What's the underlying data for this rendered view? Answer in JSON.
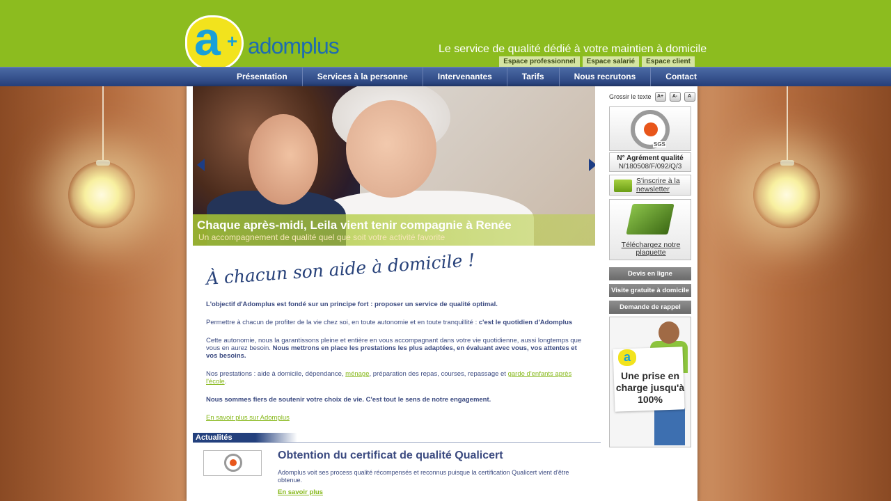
{
  "brand": {
    "name": "adomplus",
    "logo_letter": "a",
    "logo_plus": "+",
    "tagline": "Le service de qualité dédié à votre maintien à domicile",
    "colors": {
      "green": "#8cbc1f",
      "navy": "#263f7a",
      "yellow": "#f2e31d",
      "blue": "#1aa0d8"
    }
  },
  "spaces": [
    {
      "label": "Espace professionnel"
    },
    {
      "label": "Espace salarié"
    },
    {
      "label": "Espace client"
    }
  ],
  "nav": [
    {
      "label": "Présentation"
    },
    {
      "label": "Services à la personne"
    },
    {
      "label": "Intervenantes"
    },
    {
      "label": "Tarifs"
    },
    {
      "label": "Nous recrutons"
    },
    {
      "label": "Contact"
    }
  ],
  "slider": {
    "title": "Chaque après-midi, Leila vient tenir compagnie à Renée",
    "subtitle": "Un accompagnement de qualité quel que soit votre activité favorite"
  },
  "main": {
    "headline": "À chacun son aide à domicile !",
    "p1": "L'objectif d'Adomplus est fondé sur un principe fort : proposer un service de qualité optimal.",
    "p2_text": "Permettre à chacun de profiter de la vie chez soi, en toute autonomie et en toute tranquillité : ",
    "p2_bold": "c'est le quotidien d'Adomplus",
    "p3_text": "Cette autonomie, nous la garantissons pleine et entière en vous accompagnant dans votre vie quotidienne, aussi longtemps que vous en aurez besoin. ",
    "p3_bold": "Nous mettrons en place les prestations les plus adaptées, en évaluant avec vous, vos attentes et vos besoins.",
    "p4_a": "Nos prestations : aide à domicile, dépendance, ",
    "p4_link1": "ménage",
    "p4_b": ", préparation des repas, courses, repassage et ",
    "p4_link2": "garde d'enfants après l'école",
    "p4_c": ".",
    "p5": "Nous sommes fiers de soutenir votre choix de vie. C'est tout le sens de notre engagement.",
    "more_link": "En savoir plus sur Adomplus"
  },
  "news": {
    "section_label": "Actualités",
    "title": "Obtention du certificat de qualité Qualicert",
    "text": "Adomplus voit ses process qualité récompensés et reconnus puisque la certification Qualicert vient d'être obtenue.",
    "link": "En savoir plus"
  },
  "sidebar": {
    "text_size_label": "Grossir le texte",
    "text_size_buttons": [
      "A+",
      "A-",
      "A"
    ],
    "cert_label": "SGS",
    "agreement_title": "N° Agrément qualité",
    "agreement_number": "N/180508/F/092/Q/3",
    "newsletter": "S'inscrire à la newsletter",
    "download": "Téléchargez notre plaquette",
    "buttons": [
      {
        "label": "Devis en ligne"
      },
      {
        "label": "Visite gratuite à domicile"
      },
      {
        "label": "Demande de rappel"
      }
    ],
    "promo_text": "Une prise en charge jusqu'à 100%"
  }
}
